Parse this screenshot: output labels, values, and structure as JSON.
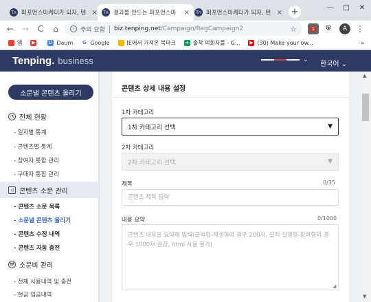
{
  "tabs": [
    {
      "icon": "Tn",
      "title": "퍼포먼스마케터가 되자, 텐",
      "close": "×"
    },
    {
      "icon": "Tn",
      "title": "결과를 만드는 퍼포먼스마",
      "close": "×"
    },
    {
      "icon": "Tn",
      "title": "퍼포먼스마케터가 되자, 텐",
      "close": "×"
    }
  ],
  "new_tab": "+",
  "window_controls": {
    "minimize": "—",
    "maximize": "□",
    "close": "✕"
  },
  "toolbar": {
    "back": "←",
    "forward": "→",
    "reload": "C",
    "home": "⌂",
    "security_label": "주의 요함",
    "url_host": "biz.tenping.net",
    "url_path": "/Campaign/RegCampaign2",
    "star": "☆",
    "ext_badge": "1",
    "avatar": "A",
    "menu": "⋮"
  },
  "bookmarks": [
    {
      "label": "앱",
      "icon_color": "#ea4335"
    },
    {
      "label": "",
      "icon_color": "#e53935"
    },
    {
      "label": "Daum",
      "icon_color": "#4285f4"
    },
    {
      "label": "Google",
      "icon_color": "#34a853"
    },
    {
      "label": "IE에서 가져온 북마크",
      "icon_color": "#f4b400"
    },
    {
      "label": "출착 의회자를 - G...",
      "icon_color": "#0f9d58"
    },
    {
      "label": "(30) Make your ow...",
      "icon_color": "#ff0000"
    }
  ],
  "bookmarks_more": "»",
  "site": {
    "brand": "Tenping.",
    "brand_sub": "business",
    "language": "한국어",
    "chevron": "⌄",
    "flag_colors": [
      "#e23d3d",
      "#ffffff",
      "#2d3a63"
    ]
  },
  "sidebar": {
    "upload_button": "소문낼 콘텐츠 올리기",
    "sections": [
      {
        "title": "전체 현황",
        "icon": "◔",
        "items": [
          "- 일자별 통계",
          "- 콘텐츠별 통계",
          "- 참여자 통합 관리",
          "- 구매자 통합 관리"
        ]
      },
      {
        "title": "콘텐츠 소문 관리",
        "icon": "◁",
        "items": [
          "- 콘텐츠 소문 목록",
          "- 소문낼 콘텐츠 올리기",
          "- 콘텐츠 수정 내역",
          "- 콘텐츠 자동 충전"
        ]
      },
      {
        "title": "소문비 관리",
        "icon": "₩",
        "items": [
          "- 전체 사용내역 및 충전",
          "- 현금 입금내역"
        ]
      }
    ]
  },
  "form": {
    "title": "콘텐츠 상세 내용 설정",
    "category1_label": "1차 카테고리",
    "category1_value": "1차 카테고리 선택",
    "category2_label": "2차 카테고리",
    "category2_value": "2차 카테고리 선택",
    "title_label": "제목",
    "title_count": "0/35",
    "title_placeholder": "콘텐츠 제목 입력",
    "summary_label": "내용 요약",
    "summary_count": "0/1000",
    "summary_placeholder": "콘텐츠 내용을 요약해 입력(클릭형-재생형의 경우 200자, 설치 실행형-참여형의 경우 1000자 권장, html 사용 불가)",
    "arrow": "▼"
  },
  "scroll": {
    "up": "▲",
    "down": "▼"
  }
}
